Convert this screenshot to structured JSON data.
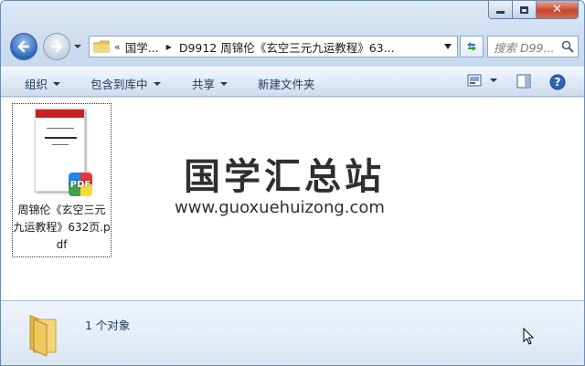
{
  "navigation": {
    "address_overflow": "«",
    "address_crumb_1": "国学...",
    "address_crumb_2": "D9912 周锦伦《玄空三元九运教程》63...",
    "search_placeholder": "搜索 D99..."
  },
  "toolbar": {
    "organize": "组织",
    "include_in_library": "包含到库中",
    "share": "共享",
    "new_folder": "新建文件夹"
  },
  "files": [
    {
      "name": "周锦伦《玄空三元九运教程》632页.pdf",
      "badge": "PDF"
    }
  ],
  "watermark": {
    "title": "国学汇总站",
    "url": "www.guoxuehuizong.com"
  },
  "details": {
    "item_count": "1 个对象"
  },
  "icons": {
    "back": "back-arrow-icon",
    "forward": "forward-arrow-icon",
    "refresh": "refresh-icon",
    "search": "search-icon",
    "view": "view-options-icon",
    "preview_pane": "preview-pane-icon",
    "help": "help-icon",
    "folder": "folder-icon"
  },
  "colors": {
    "accent": "#1e395b",
    "titlebar": "#c8daee",
    "close": "#c8442b"
  }
}
